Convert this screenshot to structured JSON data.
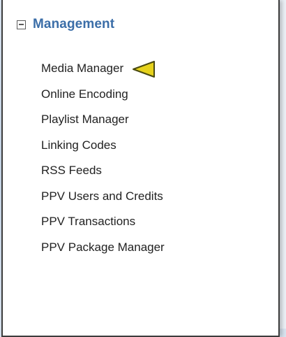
{
  "section": {
    "title": "Management",
    "toggle_icon": "collapse-minus-icon",
    "items": [
      {
        "label": "Media Manager",
        "highlighted": true
      },
      {
        "label": "Online Encoding"
      },
      {
        "label": "Playlist Manager"
      },
      {
        "label": "Linking Codes"
      },
      {
        "label": "RSS Feeds"
      },
      {
        "label": "PPV Users and Credits"
      },
      {
        "label": "PPV Transactions"
      },
      {
        "label": "PPV Package Manager"
      }
    ]
  },
  "pointer": {
    "icon": "yellow-triangle-pointer-icon",
    "fill": "#e6d21c",
    "stroke": "#4a4a10"
  },
  "colors": {
    "title": "#3b6ea8",
    "item_text": "#222222",
    "panel_border": "#3c3c3c"
  }
}
